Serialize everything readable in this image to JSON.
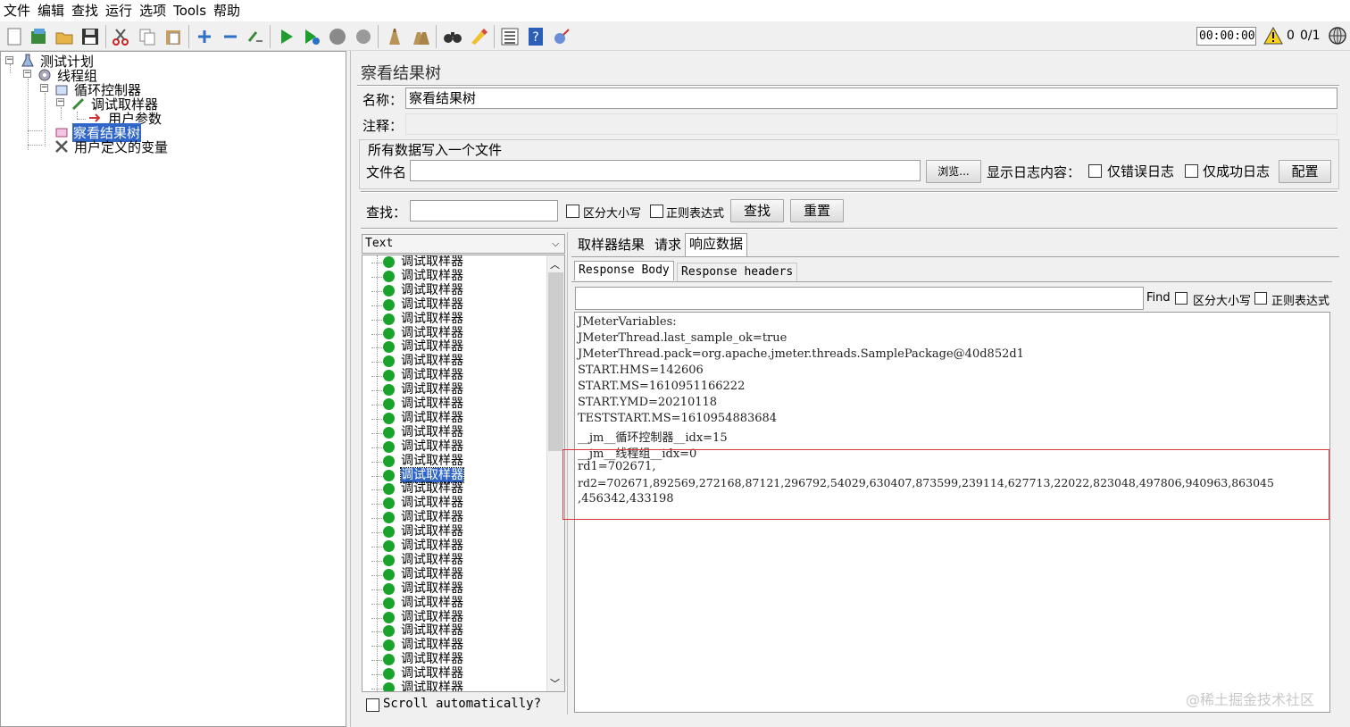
{
  "menu": [
    "文件",
    "编辑",
    "查找",
    "运行",
    "选项",
    "Tools",
    "帮助"
  ],
  "toolbar": {
    "timer": "00:00:00",
    "warnings": "0",
    "threads": "0/1",
    "icons": [
      "new-icon",
      "templates-icon",
      "open-icon",
      "save-icon",
      "cut-icon",
      "copy-icon",
      "paste-icon",
      "expand-icon",
      "collapse-icon",
      "toggle-icon",
      "start-icon",
      "start-no-pause-icon",
      "stop-icon",
      "shutdown-icon",
      "clear-icon",
      "clear-all-icon",
      "search-icon",
      "reset-search-icon",
      "function-helper-icon",
      "help-icon",
      "remote-icon"
    ]
  },
  "tree": {
    "nodes": [
      {
        "label": "测试计划",
        "icon": "test-plan-icon",
        "selected": false
      },
      {
        "label": "线程组",
        "icon": "thread-group-icon",
        "selected": false
      },
      {
        "label": "循环控制器",
        "icon": "loop-controller-icon",
        "selected": false
      },
      {
        "label": "调试取样器",
        "icon": "debug-sampler-icon",
        "selected": false
      },
      {
        "label": "用户参数",
        "icon": "user-params-icon",
        "selected": false
      },
      {
        "label": "察看结果树",
        "icon": "result-tree-icon",
        "selected": true
      },
      {
        "label": "用户定义的变量",
        "icon": "user-vars-icon",
        "selected": false
      }
    ]
  },
  "panel": {
    "title": "察看结果树",
    "name_label": "名称：",
    "name_value": "察看结果树",
    "comment_label": "注释：",
    "file_section": "所有数据写入一个文件",
    "filename_label": "文件名",
    "browse_button": "浏览...",
    "log_label": "显示日志内容：",
    "errors_only": "仅错误日志",
    "success_only": "仅成功日志",
    "config_button": "配置",
    "search_label": "查找：",
    "case_sensitive": "区分大小写",
    "regex": "正则表达式",
    "find_button": "查找",
    "reset_button": "重置"
  },
  "results": {
    "mode": "Text",
    "item_label": "调试取样器",
    "item_count": 31,
    "selected_index": 15,
    "scroll_auto": "Scroll automatically?"
  },
  "tabs": [
    "取样器结果",
    "请求",
    "响应数据"
  ],
  "active_tab": 2,
  "subtabs": [
    "Response Body",
    "Response headers"
  ],
  "find": {
    "label": "Find",
    "case_sensitive": "区分大小写",
    "regex": "正则表达式"
  },
  "response_lines": [
    "JMeterVariables:",
    "JMeterThread.last_sample_ok=true",
    "JMeterThread.pack=org.apache.jmeter.threads.SamplePackage@40d852d1",
    "START.HMS=142606",
    "START.MS=1610951166222",
    "START.YMD=20210118",
    "TESTSTART.MS=1610954883684",
    "__jm__循环控制器__idx=15",
    "__jm__线程组__idx=0",
    "rd1=702671,",
    "rd2=702671,892569,272168,87121,296792,54029,630407,873599,239114,627713,22022,823048,497806,940963,863045",
    ",456342,433198"
  ],
  "watermark": "@稀土掘金技术社区"
}
